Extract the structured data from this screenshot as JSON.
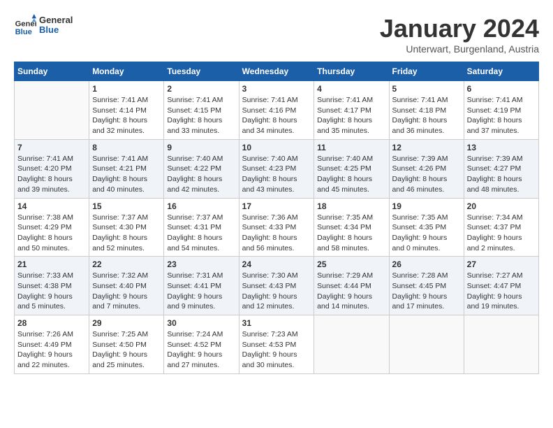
{
  "header": {
    "logo_line1": "General",
    "logo_line2": "Blue",
    "title": "January 2024",
    "subtitle": "Unterwart, Burgenland, Austria"
  },
  "weekdays": [
    "Sunday",
    "Monday",
    "Tuesday",
    "Wednesday",
    "Thursday",
    "Friday",
    "Saturday"
  ],
  "weeks": [
    [
      {
        "day": "",
        "info": ""
      },
      {
        "day": "1",
        "info": "Sunrise: 7:41 AM\nSunset: 4:14 PM\nDaylight: 8 hours\nand 32 minutes."
      },
      {
        "day": "2",
        "info": "Sunrise: 7:41 AM\nSunset: 4:15 PM\nDaylight: 8 hours\nand 33 minutes."
      },
      {
        "day": "3",
        "info": "Sunrise: 7:41 AM\nSunset: 4:16 PM\nDaylight: 8 hours\nand 34 minutes."
      },
      {
        "day": "4",
        "info": "Sunrise: 7:41 AM\nSunset: 4:17 PM\nDaylight: 8 hours\nand 35 minutes."
      },
      {
        "day": "5",
        "info": "Sunrise: 7:41 AM\nSunset: 4:18 PM\nDaylight: 8 hours\nand 36 minutes."
      },
      {
        "day": "6",
        "info": "Sunrise: 7:41 AM\nSunset: 4:19 PM\nDaylight: 8 hours\nand 37 minutes."
      }
    ],
    [
      {
        "day": "7",
        "info": "Sunrise: 7:41 AM\nSunset: 4:20 PM\nDaylight: 8 hours\nand 39 minutes."
      },
      {
        "day": "8",
        "info": "Sunrise: 7:41 AM\nSunset: 4:21 PM\nDaylight: 8 hours\nand 40 minutes."
      },
      {
        "day": "9",
        "info": "Sunrise: 7:40 AM\nSunset: 4:22 PM\nDaylight: 8 hours\nand 42 minutes."
      },
      {
        "day": "10",
        "info": "Sunrise: 7:40 AM\nSunset: 4:23 PM\nDaylight: 8 hours\nand 43 minutes."
      },
      {
        "day": "11",
        "info": "Sunrise: 7:40 AM\nSunset: 4:25 PM\nDaylight: 8 hours\nand 45 minutes."
      },
      {
        "day": "12",
        "info": "Sunrise: 7:39 AM\nSunset: 4:26 PM\nDaylight: 8 hours\nand 46 minutes."
      },
      {
        "day": "13",
        "info": "Sunrise: 7:39 AM\nSunset: 4:27 PM\nDaylight: 8 hours\nand 48 minutes."
      }
    ],
    [
      {
        "day": "14",
        "info": "Sunrise: 7:38 AM\nSunset: 4:29 PM\nDaylight: 8 hours\nand 50 minutes."
      },
      {
        "day": "15",
        "info": "Sunrise: 7:37 AM\nSunset: 4:30 PM\nDaylight: 8 hours\nand 52 minutes."
      },
      {
        "day": "16",
        "info": "Sunrise: 7:37 AM\nSunset: 4:31 PM\nDaylight: 8 hours\nand 54 minutes."
      },
      {
        "day": "17",
        "info": "Sunrise: 7:36 AM\nSunset: 4:33 PM\nDaylight: 8 hours\nand 56 minutes."
      },
      {
        "day": "18",
        "info": "Sunrise: 7:35 AM\nSunset: 4:34 PM\nDaylight: 8 hours\nand 58 minutes."
      },
      {
        "day": "19",
        "info": "Sunrise: 7:35 AM\nSunset: 4:35 PM\nDaylight: 9 hours\nand 0 minutes."
      },
      {
        "day": "20",
        "info": "Sunrise: 7:34 AM\nSunset: 4:37 PM\nDaylight: 9 hours\nand 2 minutes."
      }
    ],
    [
      {
        "day": "21",
        "info": "Sunrise: 7:33 AM\nSunset: 4:38 PM\nDaylight: 9 hours\nand 5 minutes."
      },
      {
        "day": "22",
        "info": "Sunrise: 7:32 AM\nSunset: 4:40 PM\nDaylight: 9 hours\nand 7 minutes."
      },
      {
        "day": "23",
        "info": "Sunrise: 7:31 AM\nSunset: 4:41 PM\nDaylight: 9 hours\nand 9 minutes."
      },
      {
        "day": "24",
        "info": "Sunrise: 7:30 AM\nSunset: 4:43 PM\nDaylight: 9 hours\nand 12 minutes."
      },
      {
        "day": "25",
        "info": "Sunrise: 7:29 AM\nSunset: 4:44 PM\nDaylight: 9 hours\nand 14 minutes."
      },
      {
        "day": "26",
        "info": "Sunrise: 7:28 AM\nSunset: 4:45 PM\nDaylight: 9 hours\nand 17 minutes."
      },
      {
        "day": "27",
        "info": "Sunrise: 7:27 AM\nSunset: 4:47 PM\nDaylight: 9 hours\nand 19 minutes."
      }
    ],
    [
      {
        "day": "28",
        "info": "Sunrise: 7:26 AM\nSunset: 4:49 PM\nDaylight: 9 hours\nand 22 minutes."
      },
      {
        "day": "29",
        "info": "Sunrise: 7:25 AM\nSunset: 4:50 PM\nDaylight: 9 hours\nand 25 minutes."
      },
      {
        "day": "30",
        "info": "Sunrise: 7:24 AM\nSunset: 4:52 PM\nDaylight: 9 hours\nand 27 minutes."
      },
      {
        "day": "31",
        "info": "Sunrise: 7:23 AM\nSunset: 4:53 PM\nDaylight: 9 hours\nand 30 minutes."
      },
      {
        "day": "",
        "info": ""
      },
      {
        "day": "",
        "info": ""
      },
      {
        "day": "",
        "info": ""
      }
    ]
  ]
}
